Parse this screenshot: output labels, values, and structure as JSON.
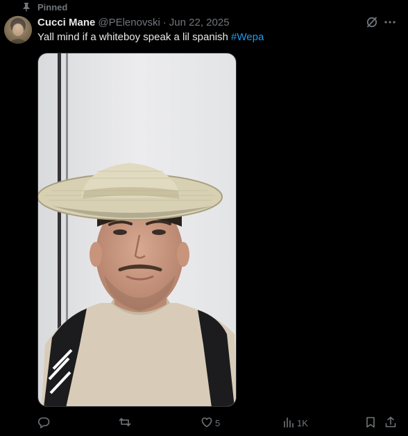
{
  "pinned": {
    "label": "Pinned",
    "icon": "pin-icon"
  },
  "author": {
    "display_name": "Cucci Mane",
    "handle": "@PElenovski",
    "separator": "·",
    "date": "Jun 22, 2025"
  },
  "post": {
    "text": "Yall mind if a whiteboy speak a lil spanish ",
    "hashtag": "#Wepa"
  },
  "header_icons": [
    "grok-icon",
    "more-icon"
  ],
  "actions": {
    "reply": {
      "icon": "reply-icon",
      "count": ""
    },
    "repost": {
      "icon": "repost-icon",
      "count": ""
    },
    "like": {
      "icon": "heart-icon",
      "count": "5"
    },
    "views": {
      "icon": "views-icon",
      "count": "1K"
    },
    "bookmark": {
      "icon": "bookmark-icon",
      "count": ""
    },
    "share": {
      "icon": "share-icon",
      "count": ""
    }
  },
  "colors": {
    "background": "#000000",
    "text_primary": "#e7e9ea",
    "text_secondary": "#71767b",
    "link": "#1d9bf0"
  }
}
